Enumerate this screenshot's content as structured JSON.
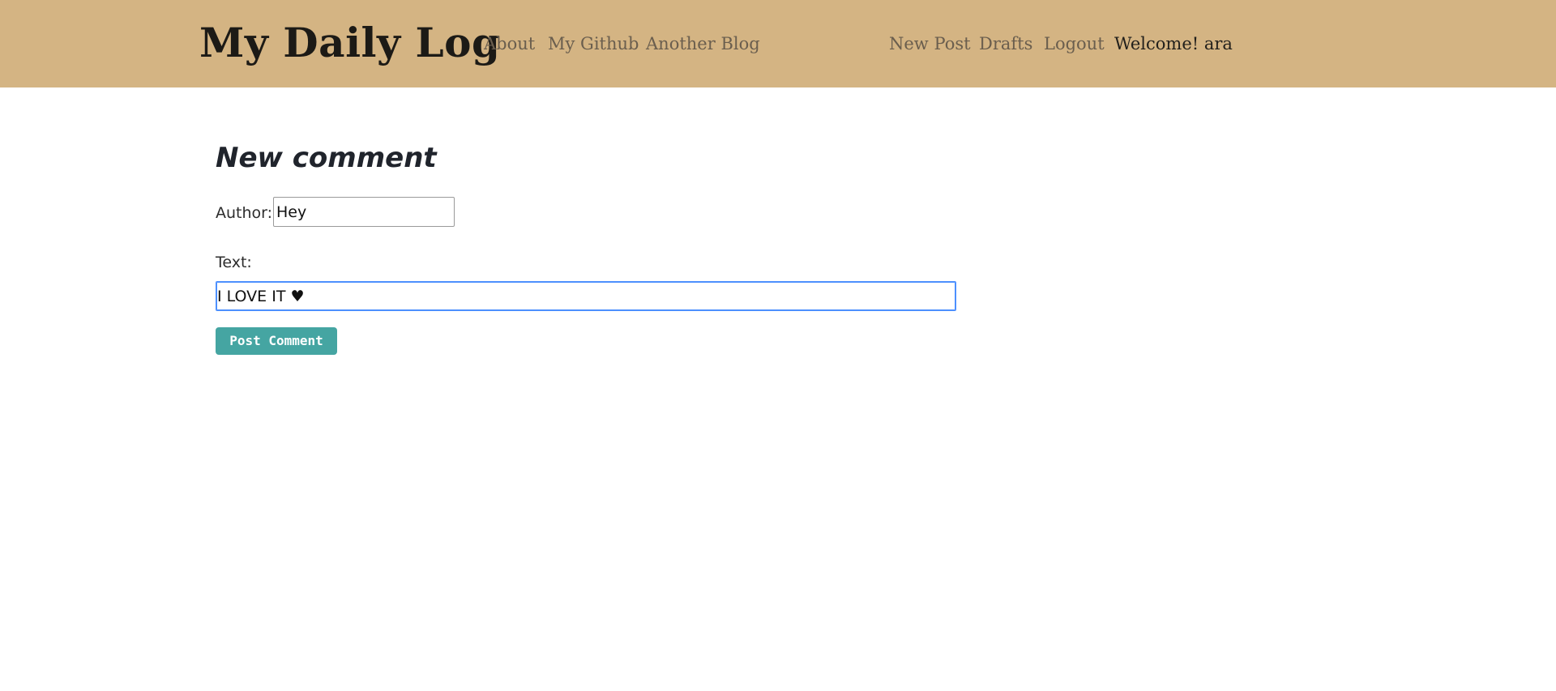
{
  "header": {
    "brand": "My Daily Log",
    "left_links": [
      "About",
      "My Github",
      "Another Blog"
    ],
    "right_links": [
      "New Post",
      "Drafts",
      "Logout"
    ],
    "welcome": "Welcome! ara"
  },
  "form": {
    "title": "New comment",
    "author_label": "Author:",
    "author_value": "Hey",
    "text_label": "Text:",
    "text_value": "I LOVE IT ♥",
    "submit_label": "Post Comment"
  },
  "colors": {
    "navbar_bg": "#d4b483",
    "button_bg": "#45a5a2",
    "focus_border": "#4d90fe"
  }
}
